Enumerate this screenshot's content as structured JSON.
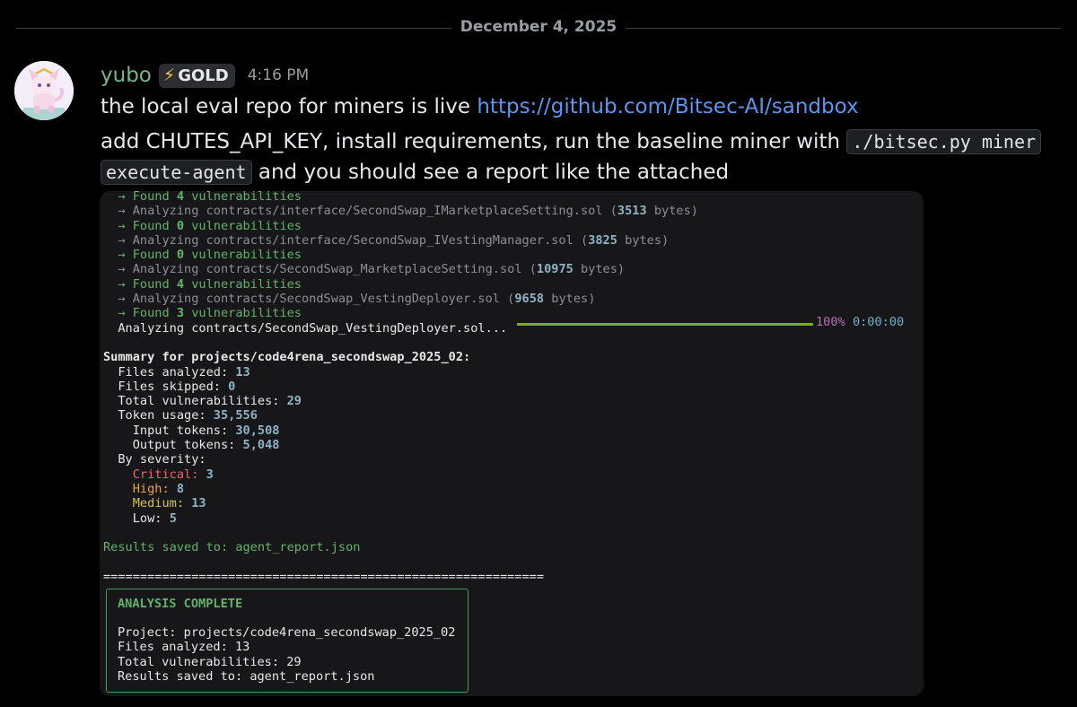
{
  "date_divider": "December 4, 2025",
  "message": {
    "username": "yubo",
    "badge": "GOLD",
    "timestamp": "4:16 PM",
    "line1_text": "the local eval repo for miners is live ",
    "line1_link": "https://github.com/Bitsec-AI/sandbox",
    "line2_text": "add CHUTES_API_KEY, install requirements, run the baseline miner with ",
    "line2_code": "./bitsec.py miner",
    "line3_code": "execute-agent",
    "line3_text": " and you should see a report like the attached"
  },
  "terminal": {
    "arrow": "→",
    "found_prefix": "Found ",
    "found_suffix": " vulnerabilities",
    "analyzing_prefix": "Analyzing ",
    "bytes_suffix": " bytes)",
    "cutoff_found_count": "4",
    "log": [
      {
        "file": "contracts/interface/SecondSwap_IMarketplaceSetting.sol",
        "bytes": "3513",
        "found": "0"
      },
      {
        "file": "contracts/interface/SecondSwap_IVestingManager.sol",
        "bytes": "3825",
        "found": "0"
      },
      {
        "file": "contracts/SecondSwap_MarketplaceSetting.sol",
        "bytes": "10975",
        "found": "4"
      },
      {
        "file": "contracts/SecondSwap_VestingDeployer.sol",
        "bytes": "9658",
        "found": "3"
      }
    ],
    "progress_label": "Analyzing contracts/SecondSwap_VestingDeployer.sol...",
    "progress_pct": "100%",
    "progress_eta": "0:00:00",
    "progress_fraction": 1.0,
    "summary_title": "Summary for projects/code4rena_secondswap_2025_02:",
    "files_analyzed_label": "Files analyzed: ",
    "files_analyzed": "13",
    "files_skipped_label": "Files skipped: ",
    "files_skipped": "0",
    "total_vulns_label": "Total vulnerabilities: ",
    "total_vulns": "29",
    "token_usage_label": "Token usage: ",
    "token_usage": "35,556",
    "input_tokens_label": "Input tokens: ",
    "input_tokens": "30,508",
    "output_tokens_label": "Output tokens: ",
    "output_tokens": "5,048",
    "by_severity_label": "By severity:",
    "critical_label": "Critical:",
    "critical": "3",
    "high_label": "High:",
    "high": "8",
    "medium_label": "Medium:",
    "medium": "13",
    "low_label": "Low:",
    "low": "5",
    "results_saved": "Results saved to: agent_report.json",
    "separator": "============================================================",
    "complete_title": "ANALYSIS COMPLETE",
    "complete_project": "Project: projects/code4rena_secondswap_2025_02",
    "complete_files": "Files analyzed: 13",
    "complete_vulns": "Total vulnerabilities: 29",
    "complete_saved": "Results saved to: agent_report.json"
  },
  "colors": {
    "username": "#76b68a",
    "link": "#5a96f0",
    "success": "#62b36a",
    "critical": "#e06a6a",
    "high": "#e8a33c",
    "medium": "#d6c04a",
    "progress": "#79a82f"
  }
}
